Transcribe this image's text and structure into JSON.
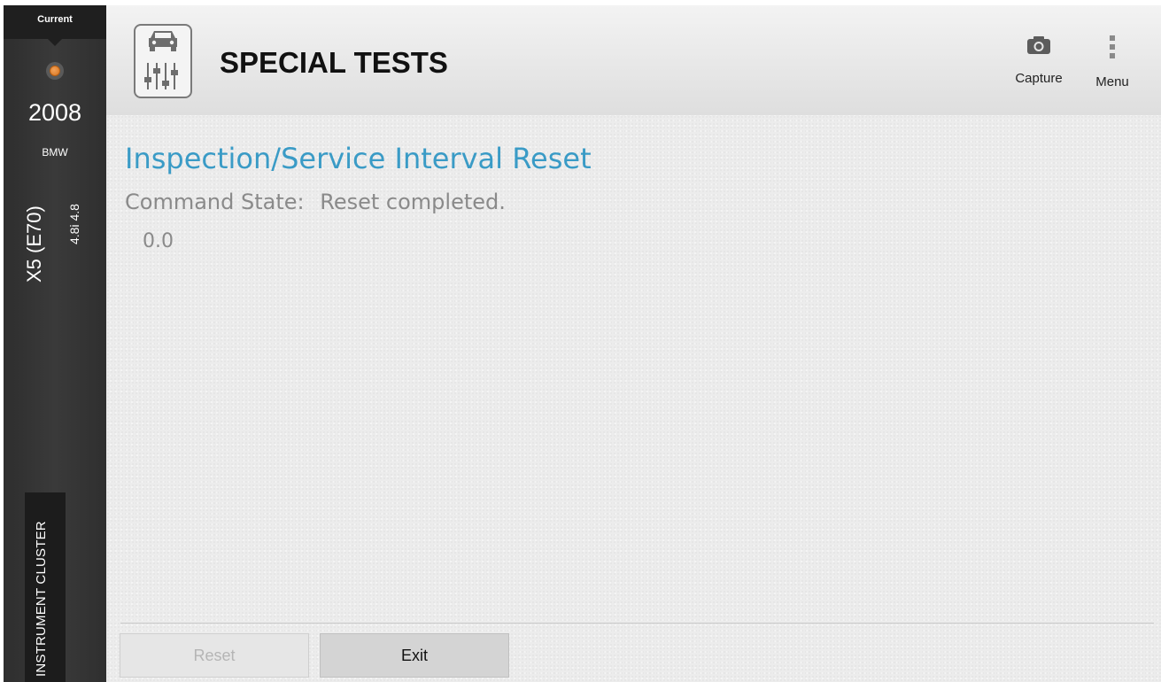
{
  "sidebar": {
    "tab_label": "Current",
    "year": "2008",
    "make": "BMW",
    "model": "X5 (E70)",
    "engine": "4.8i 4.8",
    "module": "INSTRUMENT CLUSTER",
    "connection_icon": "connection-status-icon",
    "connection_color": "#e8873a"
  },
  "header": {
    "title": "SPECIAL TESTS",
    "app_icon": "car-sliders-icon",
    "capture_label": "Capture",
    "capture_icon": "camera-icon",
    "menu_label": "Menu",
    "menu_icon": "kebab-menu-icon"
  },
  "main": {
    "test_title": "Inspection/Service Interval Reset",
    "command_state_label": "Command State:",
    "command_state_value": "Reset completed.",
    "value": "0.0",
    "accent_color": "#3a9bc6"
  },
  "footer": {
    "reset_label": "Reset",
    "reset_state": "disabled",
    "exit_label": "Exit"
  }
}
